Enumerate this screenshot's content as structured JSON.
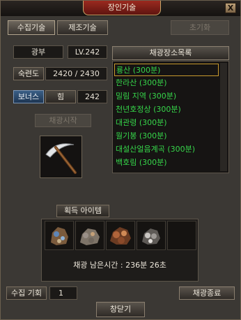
{
  "window": {
    "title": "장인기술",
    "close_label": "X"
  },
  "tabs": {
    "gather": "수집기술",
    "craft": "제조기술",
    "reset": "초기화"
  },
  "profession": {
    "name": "광부",
    "level": "LV.242"
  },
  "skill": {
    "label": "숙련도",
    "value": "2420 / 2430"
  },
  "bonus": {
    "label": "보너스",
    "stat": "힘",
    "value": "242"
  },
  "actions": {
    "start": "채광시작",
    "stop": "채광종료",
    "close": "창닫기"
  },
  "tool": {
    "icon": "pickaxe-icon"
  },
  "location_list": {
    "header": "채광장소목록",
    "selected_index": 0,
    "items": [
      "룡산 (300분)",
      "한라산 (300분)",
      "밀림 지역 (300분)",
      "천년호정상 (300분)",
      "대관령 (300분)",
      "월기봉 (300분)",
      "대설산얼음계곡 (300분)",
      "백호림 (300분)"
    ]
  },
  "acquired": {
    "title": "획득 아이템",
    "items": [
      {
        "icon": "blue-ore-icon"
      },
      {
        "icon": "gray-ore-icon"
      },
      {
        "icon": "copper-ore-icon"
      },
      {
        "icon": "silver-ore-icon"
      },
      {
        "icon": "empty-slot"
      }
    ],
    "timer_text": "채광 남은시간 : 236분 26초"
  },
  "gather_chance": {
    "label": "수집 기회",
    "value": "1"
  },
  "colors": {
    "list_text": "#36d64a",
    "selected_outline": "#c99a2e",
    "title_plate": "#9b2a1f",
    "bonus_label": "#3b5f86"
  }
}
